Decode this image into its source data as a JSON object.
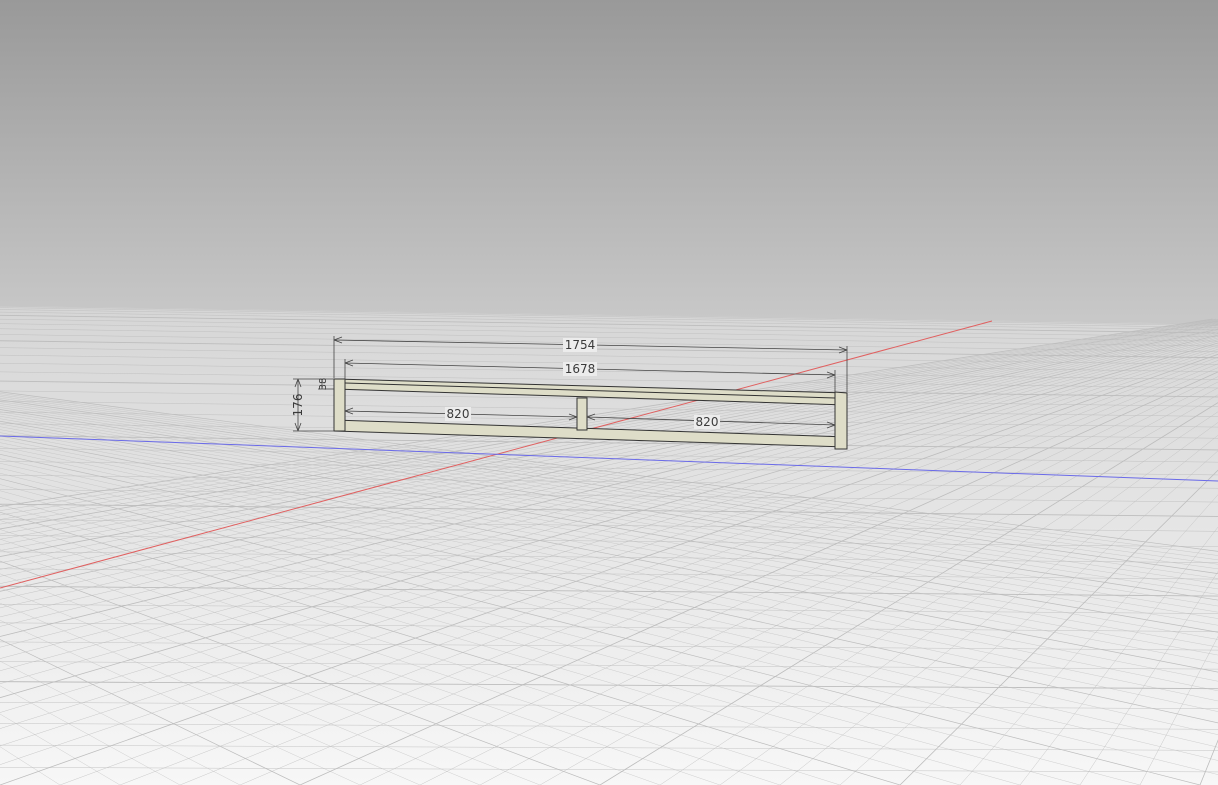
{
  "viewport": {
    "sky_top_color": "#999999",
    "sky_horizon_color": "#c9c9c9",
    "ground_near_color": "#f7f7f7",
    "ground_far_color": "#d6d6d6",
    "grid_line_color": "#bdbdbd",
    "x_axis_color": "#e06060",
    "y_axis_color": "#6a6ae8",
    "model_face_color": "#deddc8",
    "model_edge_color": "#333333"
  },
  "dimensions": {
    "overall_width": "1754",
    "inner_width": "1678",
    "left_bay": "820",
    "right_bay": "820",
    "height": "176",
    "rail_thickness": "38"
  }
}
